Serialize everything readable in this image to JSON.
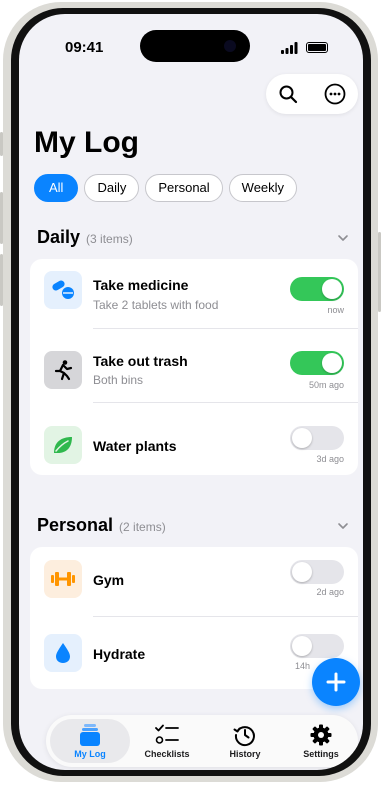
{
  "status": {
    "time": "09:41"
  },
  "page": {
    "title": "My Log"
  },
  "filters": [
    "All",
    "Daily",
    "Personal",
    "Weekly"
  ],
  "sections": [
    {
      "name": "Daily",
      "count": "(3 items)",
      "items": [
        {
          "title": "Take medicine",
          "subtitle": "Take 2 tablets with food",
          "time": "now",
          "done": true,
          "icon": "pills-icon"
        },
        {
          "title": "Take out trash",
          "subtitle": "Both bins",
          "time": "50m ago",
          "done": true,
          "icon": "running-person-icon"
        },
        {
          "title": "Water plants",
          "subtitle": "",
          "time": "3d ago",
          "done": false,
          "icon": "leaf-icon"
        }
      ]
    },
    {
      "name": "Personal",
      "count": "(2 items)",
      "items": [
        {
          "title": "Gym",
          "subtitle": "",
          "time": "2d ago",
          "done": false,
          "icon": "dumbbell-icon"
        },
        {
          "title": "Hydrate",
          "subtitle": "",
          "time": "14h",
          "done": false,
          "icon": "water-drop-icon"
        }
      ]
    }
  ],
  "tabs": [
    {
      "label": "My Log",
      "icon": "stack-icon",
      "active": true
    },
    {
      "label": "Checklists",
      "icon": "checklist-icon",
      "active": false
    },
    {
      "label": "History",
      "icon": "history-icon",
      "active": false
    },
    {
      "label": "Settings",
      "icon": "gear-icon",
      "active": false
    }
  ],
  "colors": {
    "accent": "#0a84ff",
    "toggle_on": "#34c759",
    "background": "#f2f2f7"
  }
}
